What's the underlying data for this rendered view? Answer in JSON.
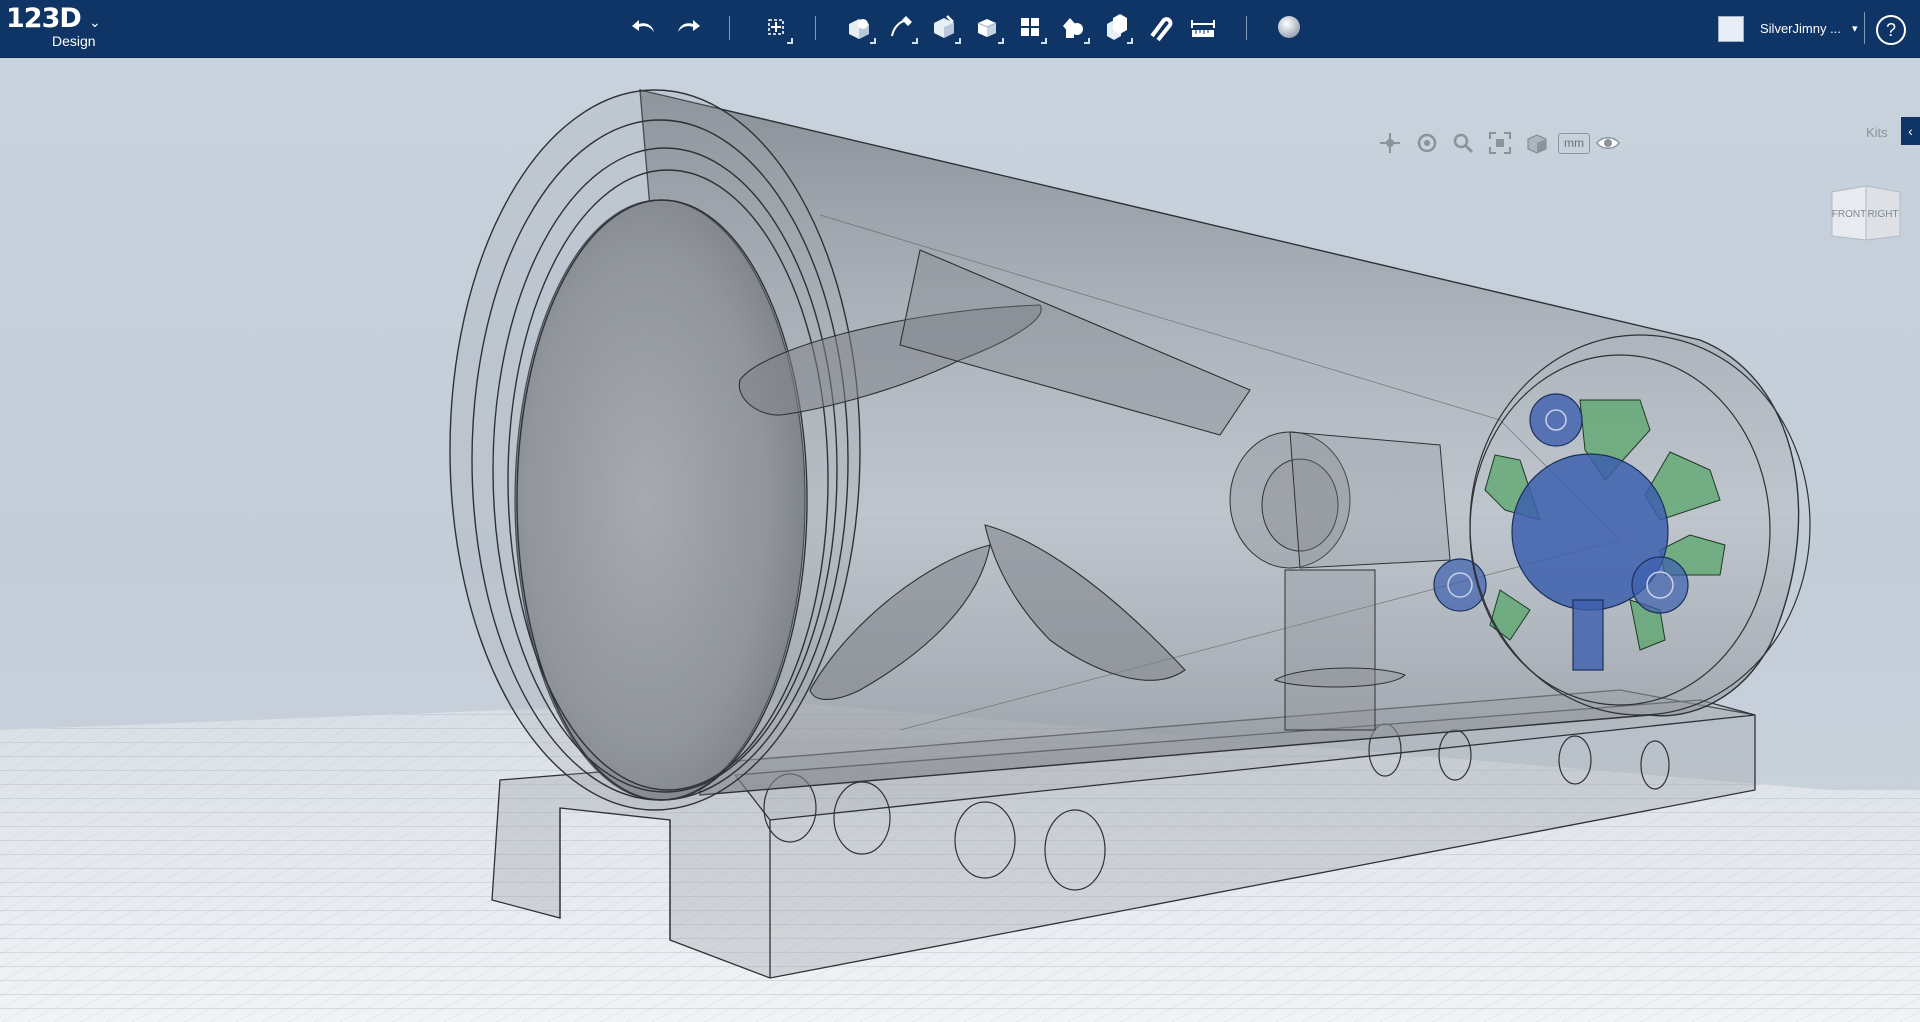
{
  "app": {
    "logo_main": "123D",
    "logo_sub": "Design",
    "logo_chevron": "⌄"
  },
  "toolbar": {
    "buttons": [
      {
        "name": "undo-button",
        "icon": "undo-icon"
      },
      {
        "name": "redo-button",
        "icon": "redo-icon"
      },
      {
        "name": "transform-button",
        "icon": "transform-icon"
      },
      {
        "name": "primitives-button",
        "icon": "primitives-icon"
      },
      {
        "name": "sketch-button",
        "icon": "sketch-icon"
      },
      {
        "name": "construct-button",
        "icon": "construct-icon"
      },
      {
        "name": "modify-button",
        "icon": "modify-icon"
      },
      {
        "name": "pattern-button",
        "icon": "pattern-icon"
      },
      {
        "name": "grouping-button",
        "icon": "grouping-icon"
      },
      {
        "name": "combine-button",
        "icon": "combine-icon"
      },
      {
        "name": "snap-button",
        "icon": "snap-icon"
      },
      {
        "name": "measure-button",
        "icon": "measure-icon"
      },
      {
        "name": "material-button",
        "icon": "material-sphere-icon"
      }
    ]
  },
  "user": {
    "name": "SilverJimny ...",
    "dropdown": "▾",
    "help": "?"
  },
  "view": {
    "nav_tools": [
      "pan-icon",
      "orbit-icon",
      "zoom-icon",
      "fit-icon",
      "view-mode-icon",
      "visibility-icon"
    ],
    "units": "mm",
    "kits_label": "Kits",
    "kits_tab": "‹",
    "viewcube": {
      "front": "FRONT",
      "right": "RIGHT"
    }
  },
  "colors": {
    "topbar": "#0f3566",
    "part_blue": "#3d5fae",
    "part_green": "#5aa66b",
    "model_gray": "#8d9196"
  }
}
